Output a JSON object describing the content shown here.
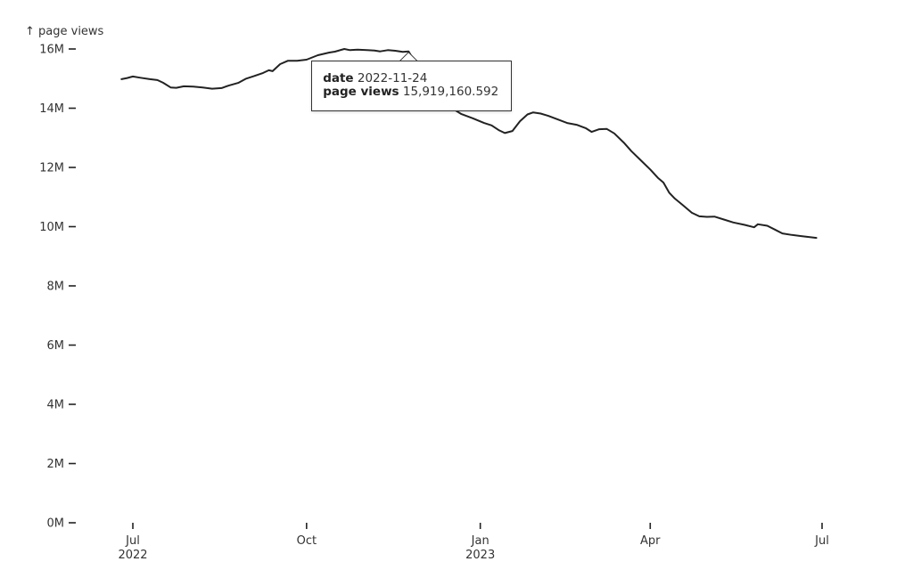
{
  "chart_data": {
    "type": "line",
    "title": "",
    "xlabel": "",
    "ylabel": "↑ page views",
    "ylim": [
      0,
      16000000
    ],
    "xlim": [
      "2022-06-19",
      "2023-07-06"
    ],
    "grid": false,
    "y_ticks": [
      {
        "value": 0,
        "label": "0M"
      },
      {
        "value": 2000000,
        "label": "2M"
      },
      {
        "value": 4000000,
        "label": "4M"
      },
      {
        "value": 6000000,
        "label": "6M"
      },
      {
        "value": 8000000,
        "label": "8M"
      },
      {
        "value": 10000000,
        "label": "10M"
      },
      {
        "value": 12000000,
        "label": "12M"
      },
      {
        "value": 14000000,
        "label": "14M"
      },
      {
        "value": 16000000,
        "label": "16M"
      }
    ],
    "x_ticks": [
      {
        "date": "2022-07-01",
        "label": "Jul",
        "sublabel": "2022"
      },
      {
        "date": "2022-10-01",
        "label": "Oct",
        "sublabel": ""
      },
      {
        "date": "2023-01-01",
        "label": "Jan",
        "sublabel": "2023"
      },
      {
        "date": "2023-04-01",
        "label": "Apr",
        "sublabel": ""
      },
      {
        "date": "2023-07-01",
        "label": "Jul",
        "sublabel": ""
      }
    ],
    "series": [
      {
        "name": "page views",
        "color": "#222222",
        "points": [
          [
            "2022-06-25",
            14980000
          ],
          [
            "2022-06-28",
            15020000
          ],
          [
            "2022-07-01",
            15070000
          ],
          [
            "2022-07-05",
            15030000
          ],
          [
            "2022-07-10",
            14980000
          ],
          [
            "2022-07-14",
            14950000
          ],
          [
            "2022-07-17",
            14860000
          ],
          [
            "2022-07-21",
            14700000
          ],
          [
            "2022-07-24",
            14690000
          ],
          [
            "2022-07-28",
            14740000
          ],
          [
            "2022-08-02",
            14730000
          ],
          [
            "2022-08-07",
            14700000
          ],
          [
            "2022-08-12",
            14660000
          ],
          [
            "2022-08-17",
            14680000
          ],
          [
            "2022-08-21",
            14770000
          ],
          [
            "2022-08-26",
            14860000
          ],
          [
            "2022-08-30",
            15000000
          ],
          [
            "2022-09-03",
            15080000
          ],
          [
            "2022-09-08",
            15190000
          ],
          [
            "2022-09-11",
            15280000
          ],
          [
            "2022-09-13",
            15250000
          ],
          [
            "2022-09-17",
            15490000
          ],
          [
            "2022-09-21",
            15600000
          ],
          [
            "2022-09-26",
            15600000
          ],
          [
            "2022-10-01",
            15640000
          ],
          [
            "2022-10-07",
            15790000
          ],
          [
            "2022-10-13",
            15880000
          ],
          [
            "2022-10-16",
            15910000
          ],
          [
            "2022-10-21",
            16000000
          ],
          [
            "2022-10-24",
            15960000
          ],
          [
            "2022-10-28",
            15980000
          ],
          [
            "2022-11-02",
            15960000
          ],
          [
            "2022-11-06",
            15950000
          ],
          [
            "2022-11-09",
            15920000
          ],
          [
            "2022-11-13",
            15960000
          ],
          [
            "2022-11-17",
            15940000
          ],
          [
            "2022-11-21",
            15900000
          ],
          [
            "2022-11-24",
            15919160
          ],
          [
            "2022-11-27",
            15600000
          ],
          [
            "2022-12-02",
            15250000
          ],
          [
            "2022-12-07",
            14650000
          ],
          [
            "2022-12-12",
            14250000
          ],
          [
            "2022-12-17",
            14000000
          ],
          [
            "2022-12-22",
            13800000
          ],
          [
            "2022-12-28",
            13660000
          ],
          [
            "2023-01-03",
            13500000
          ],
          [
            "2023-01-07",
            13420000
          ],
          [
            "2023-01-11",
            13250000
          ],
          [
            "2023-01-14",
            13160000
          ],
          [
            "2023-01-18",
            13230000
          ],
          [
            "2023-01-22",
            13560000
          ],
          [
            "2023-01-26",
            13790000
          ],
          [
            "2023-01-29",
            13860000
          ],
          [
            "2023-02-02",
            13820000
          ],
          [
            "2023-02-06",
            13740000
          ],
          [
            "2023-02-11",
            13620000
          ],
          [
            "2023-02-16",
            13500000
          ],
          [
            "2023-02-21",
            13440000
          ],
          [
            "2023-02-26",
            13320000
          ],
          [
            "2023-03-01",
            13200000
          ],
          [
            "2023-03-05",
            13290000
          ],
          [
            "2023-03-09",
            13300000
          ],
          [
            "2023-03-13",
            13150000
          ],
          [
            "2023-03-18",
            12840000
          ],
          [
            "2023-03-22",
            12550000
          ],
          [
            "2023-03-27",
            12240000
          ],
          [
            "2023-04-01",
            11930000
          ],
          [
            "2023-04-05",
            11650000
          ],
          [
            "2023-04-08",
            11490000
          ],
          [
            "2023-04-11",
            11150000
          ],
          [
            "2023-04-14",
            10950000
          ],
          [
            "2023-04-18",
            10740000
          ],
          [
            "2023-04-23",
            10470000
          ],
          [
            "2023-04-27",
            10350000
          ],
          [
            "2023-05-01",
            10330000
          ],
          [
            "2023-05-05",
            10340000
          ],
          [
            "2023-05-10",
            10240000
          ],
          [
            "2023-05-15",
            10140000
          ],
          [
            "2023-05-21",
            10060000
          ],
          [
            "2023-05-26",
            9980000
          ],
          [
            "2023-05-28",
            10080000
          ],
          [
            "2023-06-02",
            10030000
          ],
          [
            "2023-06-06",
            9900000
          ],
          [
            "2023-06-10",
            9770000
          ],
          [
            "2023-06-15",
            9720000
          ],
          [
            "2023-06-20",
            9680000
          ],
          [
            "2023-06-24",
            9650000
          ],
          [
            "2023-06-28",
            9620000
          ]
        ]
      }
    ],
    "annotations": [],
    "tooltip": {
      "date_label": "date",
      "date_value": "2022-11-24",
      "value_label": "page views",
      "value_value": "15,919,160.592"
    }
  }
}
